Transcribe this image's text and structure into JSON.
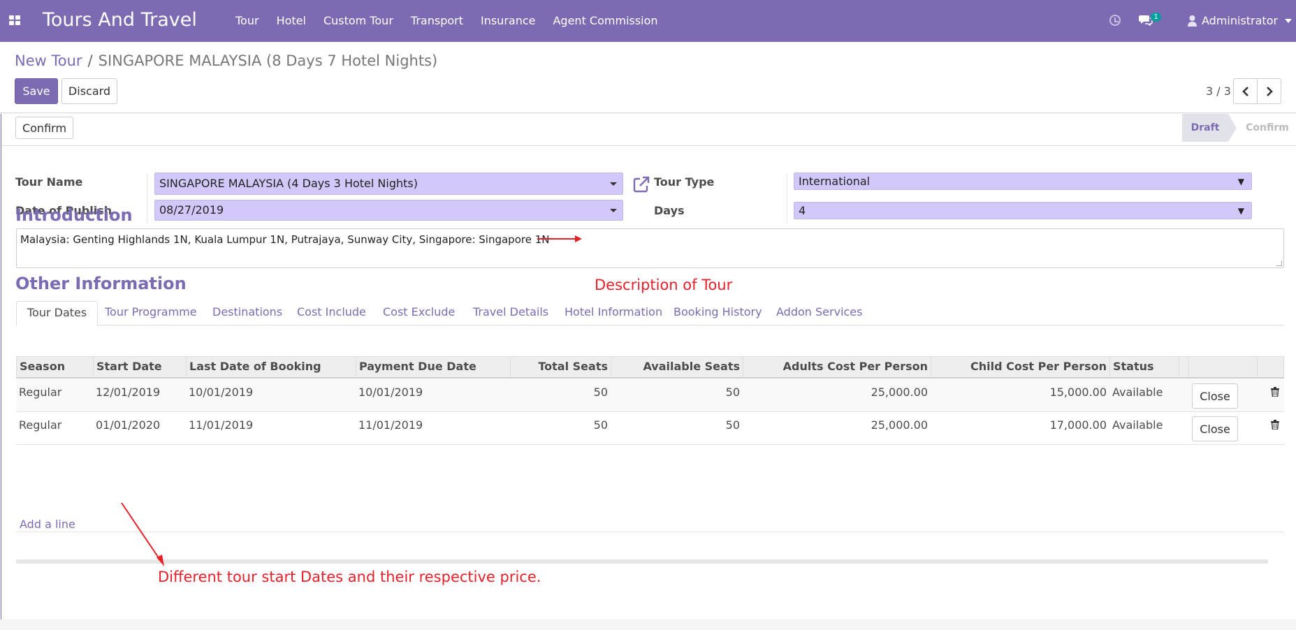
{
  "navbar": {
    "app_title": "Tours And Travel",
    "menu": [
      "Tour",
      "Hotel",
      "Custom Tour",
      "Transport",
      "Insurance",
      "Agent Commission"
    ],
    "chat_count": "1",
    "user": "Administrator",
    "color": "#7c6bb3"
  },
  "breadcrumb": {
    "parent": "New Tour",
    "separator": "/",
    "current": "SINGAPORE MALAYSIA (8 Days 7 Hotel Nights)"
  },
  "actions": {
    "save": "Save",
    "discard": "Discard"
  },
  "pager": {
    "value": "3 / 3"
  },
  "statusbar": {
    "confirm_button": "Confirm",
    "stages": [
      "Draft",
      "Confirm"
    ],
    "current_stage": "Draft"
  },
  "form": {
    "tour_name_label": "Tour Name",
    "tour_name": "SINGAPORE MALAYSIA (4 Days 3 Hotel Nights)",
    "date_of_publish_label": "Date of Publish",
    "date_of_publish": "08/27/2019",
    "tour_type_label": "Tour Type",
    "tour_type": "International",
    "days_label": "Days",
    "days": "4"
  },
  "introduction": {
    "title": "Introduction",
    "text": "Malaysia: Genting Highlands 1N, Kuala Lumpur 1N, Putrajaya, Sunway City, Singapore: Singapore 1N"
  },
  "annotations": {
    "description": "Description of Tour",
    "dates": "Different tour start Dates and their respective price.",
    "color": "#e8202a"
  },
  "other_info": {
    "title": "Other Information",
    "tabs": [
      "Tour Dates",
      "Tour Programme",
      "Destinations",
      "Cost Include",
      "Cost Exclude",
      "Travel Details",
      "Hotel Information",
      "Booking History",
      "Addon Services"
    ],
    "active_tab": "Tour Dates"
  },
  "grid": {
    "columns": [
      "Season",
      "Start Date",
      "Last Date of Booking",
      "Payment Due Date",
      "Total Seats",
      "Available Seats",
      "Adults Cost Per Person",
      "Child Cost Per Person",
      "Status"
    ],
    "rows": [
      {
        "season": "Regular",
        "start": "12/01/2019",
        "last_booking": "10/01/2019",
        "payment_due": "10/01/2019",
        "total": "50",
        "available": "50",
        "adult_cost": "25,000.00",
        "child_cost": "15,000.00",
        "status": "Available",
        "action": "Close"
      },
      {
        "season": "Regular",
        "start": "01/01/2020",
        "last_booking": "11/01/2019",
        "payment_due": "11/01/2019",
        "total": "50",
        "available": "50",
        "adult_cost": "25,000.00",
        "child_cost": "17,000.00",
        "status": "Available",
        "action": "Close"
      }
    ],
    "add_line": "Add a line"
  }
}
